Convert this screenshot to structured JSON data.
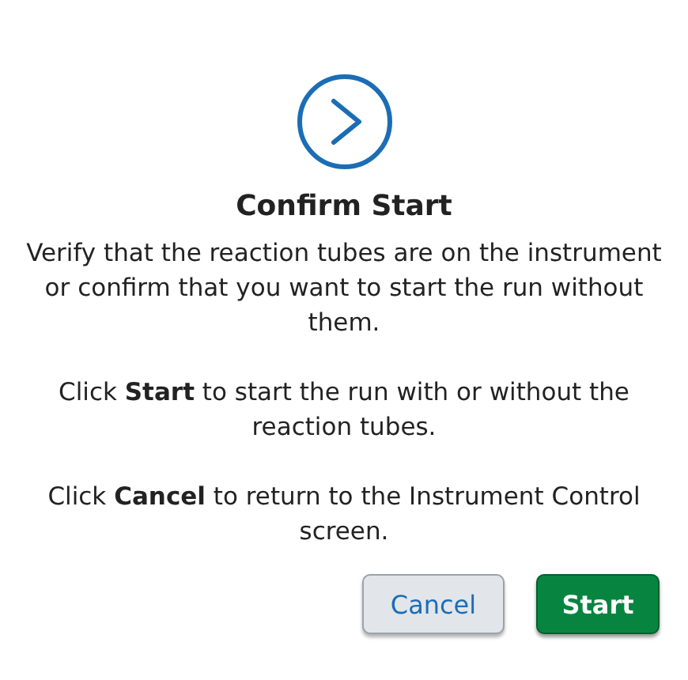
{
  "dialog": {
    "title": "Confirm Start",
    "paragraphs": [
      "Verify that the reaction tubes are on the instrument or confirm that you want to start the run without them.",
      "Click **Start** to start the run with or without the reaction tubes.",
      "Click **Cancel** to return to the Instrument Control screen."
    ],
    "buttons": [
      {
        "label": "Cancel",
        "kind": "secondary"
      },
      {
        "label": "Start",
        "kind": "primary"
      }
    ]
  }
}
